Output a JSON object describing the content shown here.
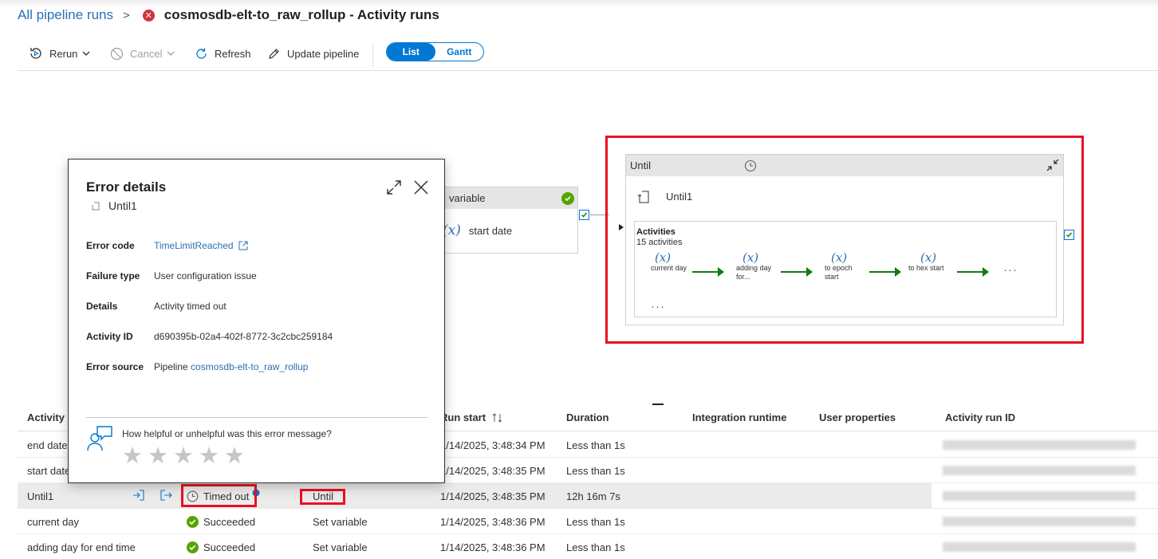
{
  "header": {
    "breadcrumb_link": "All pipeline runs",
    "separator": ">",
    "title": "cosmosdb-elt-to_raw_rollup - Activity runs",
    "status_color": "#d13438"
  },
  "toolbar": {
    "rerun": "Rerun",
    "cancel": "Cancel",
    "refresh": "Refresh",
    "update_pipeline": "Update pipeline",
    "view_list": "List",
    "view_gantt": "Gantt"
  },
  "canvas": {
    "set_variable": {
      "type_label": "variable",
      "var_symbol": "(x)",
      "name": "start date"
    },
    "until": {
      "type_label": "Until",
      "name": "Until1",
      "activities_title": "Activities",
      "activities_count": "15 activities",
      "inner_activities": [
        {
          "symbol": "(x)",
          "label": "current day"
        },
        {
          "symbol": "(x)",
          "label": "adding day for..."
        },
        {
          "symbol": "(x)",
          "label": "to epoch start"
        },
        {
          "symbol": "(x)",
          "label": "to hex start"
        }
      ],
      "more": "···"
    }
  },
  "error_dialog": {
    "title": "Error details",
    "activity_name": "Until1",
    "fields": {
      "error_code_label": "Error code",
      "error_code_value": "TimeLimitReached",
      "failure_type_label": "Failure type",
      "failure_type_value": "User configuration issue",
      "details_label": "Details",
      "details_value": "Activity timed out",
      "activity_id_label": "Activity ID",
      "activity_id_value": "d690395b-02a4-402f-8772-3c2cbc259184",
      "error_source_label": "Error source",
      "error_source_prefix": "Pipeline",
      "error_source_link": "cosmosdb-elt-to_raw_rollup"
    },
    "feedback_question": "How helpful or unhelpful was this error message?",
    "rating_stars": 5
  },
  "table": {
    "headers": {
      "activity_name": "Activity n",
      "run_start": "Run start",
      "duration": "Duration",
      "integration_runtime": "Integration runtime",
      "user_properties": "User properties",
      "activity_run_id": "Activity run ID"
    },
    "rows": [
      {
        "name": "end date",
        "status": "",
        "type": "",
        "run_start": "1/14/2025, 3:48:34 PM",
        "duration": "Less than 1s"
      },
      {
        "name": "start date",
        "status": "",
        "type": "",
        "run_start": "1/14/2025, 3:48:35 PM",
        "duration": "Less than 1s"
      },
      {
        "name": "Until1",
        "status": "Timed out",
        "type": "Until",
        "run_start": "1/14/2025, 3:48:35 PM",
        "duration": "12h 16m 7s"
      },
      {
        "name": "current day",
        "status": "Succeeded",
        "type": "Set variable",
        "run_start": "1/14/2025, 3:48:36 PM",
        "duration": "Less than 1s"
      },
      {
        "name": "adding day for end time",
        "status": "Succeeded",
        "type": "Set variable",
        "run_start": "1/14/2025, 3:48:36 PM",
        "duration": "Less than 1s"
      }
    ]
  },
  "colors": {
    "accent": "#0078d4",
    "link": "#2b6fb3",
    "success": "#57a300",
    "error": "#d13438",
    "highlight": "#e81123"
  }
}
